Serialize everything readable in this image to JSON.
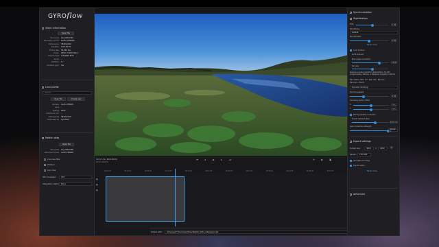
{
  "app": {
    "logo_text": "GYRO",
    "logo_script": "flow"
  },
  "left": {
    "video_info": {
      "title": "Video information",
      "open_label": "Open file",
      "rows": [
        {
          "k": "File name",
          "v": "GX_0034.MP4"
        },
        {
          "k": "Telemetry source",
          "v": "GoPro (HERO8)"
        },
        {
          "k": "Dimensions",
          "v": "3840x2160"
        },
        {
          "k": "Duration",
          "v": "0:00:30.04"
        },
        {
          "k": "Frame rate",
          "v": "59.940 fps"
        },
        {
          "k": "Codec",
          "v": "HEVC (H.265 Main)"
        },
        {
          "k": "Pixel format",
          "v": "YUV420P 8 bit"
        },
        {
          "k": "Audio",
          "v": "–"
        },
        {
          "k": "Rotation",
          "v": "0 °"
        },
        {
          "k": "Contains gyro",
          "v": "Yes"
        }
      ]
    },
    "lens_profile": {
      "title": "Lens profile",
      "search_placeholder": "Search...",
      "open_label": "Open file",
      "create_label": "Create new",
      "rows": [
        {
          "k": "Camera",
          "v": "GoPro HERO8"
        },
        {
          "k": "Lens",
          "v": "–"
        },
        {
          "k": "Setting",
          "v": "Wide"
        },
        {
          "k": "Additional info",
          "v": "–"
        },
        {
          "k": "Dimensions",
          "v": "3840x2160"
        },
        {
          "k": "Calibrated by",
          "v": "Gyroflow"
        }
      ]
    },
    "motion_data": {
      "title": "Motion data",
      "open_label": "Open file",
      "rows": [
        {
          "k": "File name",
          "v": "GX_0034.MP4"
        },
        {
          "k": "Detected format",
          "v": "GoPro HERO8"
        }
      ],
      "lowpass_label": "Low pass filter",
      "rotation_label": "Rotation",
      "gyro_bias_label": "Gyro bias",
      "imu_label": "IMU orientation",
      "imu_value": "XYZ",
      "integration_label": "Integration method",
      "integration_value": "None"
    }
  },
  "center": {
    "time_label": "00:07.19 (448/1800)",
    "fps_label": "Zoom: 60.00%",
    "ruler": [
      "00:00.00",
      "00:02.50",
      "00:05.00",
      "00:07.50",
      "00:10.00",
      "00:12.50",
      "00:15.00",
      "00:17.50",
      "00:20.00",
      "00:22.50",
      "00:25.00",
      "00:27.50"
    ],
    "output_label": "Output path:",
    "output_path": "/Volumes/TT Touch/Gyroflow/Test/GX_0034_stabilized.mp4",
    "export_label": "Export"
  },
  "right": {
    "sync": {
      "title": "Synchronization",
      "stab_title": "Stabilization",
      "fov_label": "FOV",
      "fov_value": "1.00",
      "smoothing_label": "Smoothing",
      "method_value": "Default",
      "smoothness_label": "Smoothness",
      "smoothness_value": "0.50",
      "more_label": "Show more"
    },
    "lens": {
      "title": "Lock horizon",
      "limit_label": "Limit amount",
      "max_label": "Max angle correction",
      "max_value": "15.00",
      "per_axis_label": "Per axis",
      "note": "Requires accurate orientation determination. Try with Complementary, Mahony, or Madgwick integration methods.",
      "maxrot_label": "Max rotation: Pitch: 5.7°, Yaw: 10.1°, Roll: 9.0°",
      "maxzoom_label": "Max zoom: 139.0%",
      "dynamic_label": "Dynamic zooming",
      "zoom_speed_label": "Zooming speed",
      "zoom_speed_value": "2.00",
      "zoom_center_label": "Zooming center offset",
      "x_value": "0 %",
      "y_value": "0 %",
      "rolling_label": "Rolling shutter correction",
      "frame_readout_label": "Frame readout time",
      "readout_value": "8.72 ms",
      "lens_strength_label": "Lens correction strength",
      "lens_strength_value": "100.00 %"
    },
    "export": {
      "title": "Export settings",
      "size_label": "Output size",
      "width": "3840",
      "height": "2160",
      "bitrate_label": "Bitrate",
      "bitrate_value": "150 Mbit",
      "gpu_label": "Use GPU encoding",
      "audio_label": "Export audio",
      "more_label": "Show more"
    },
    "advanced_title": "Advanced"
  },
  "colors": {
    "accent": "#2a8fe0",
    "bg": "#1c1c20"
  }
}
